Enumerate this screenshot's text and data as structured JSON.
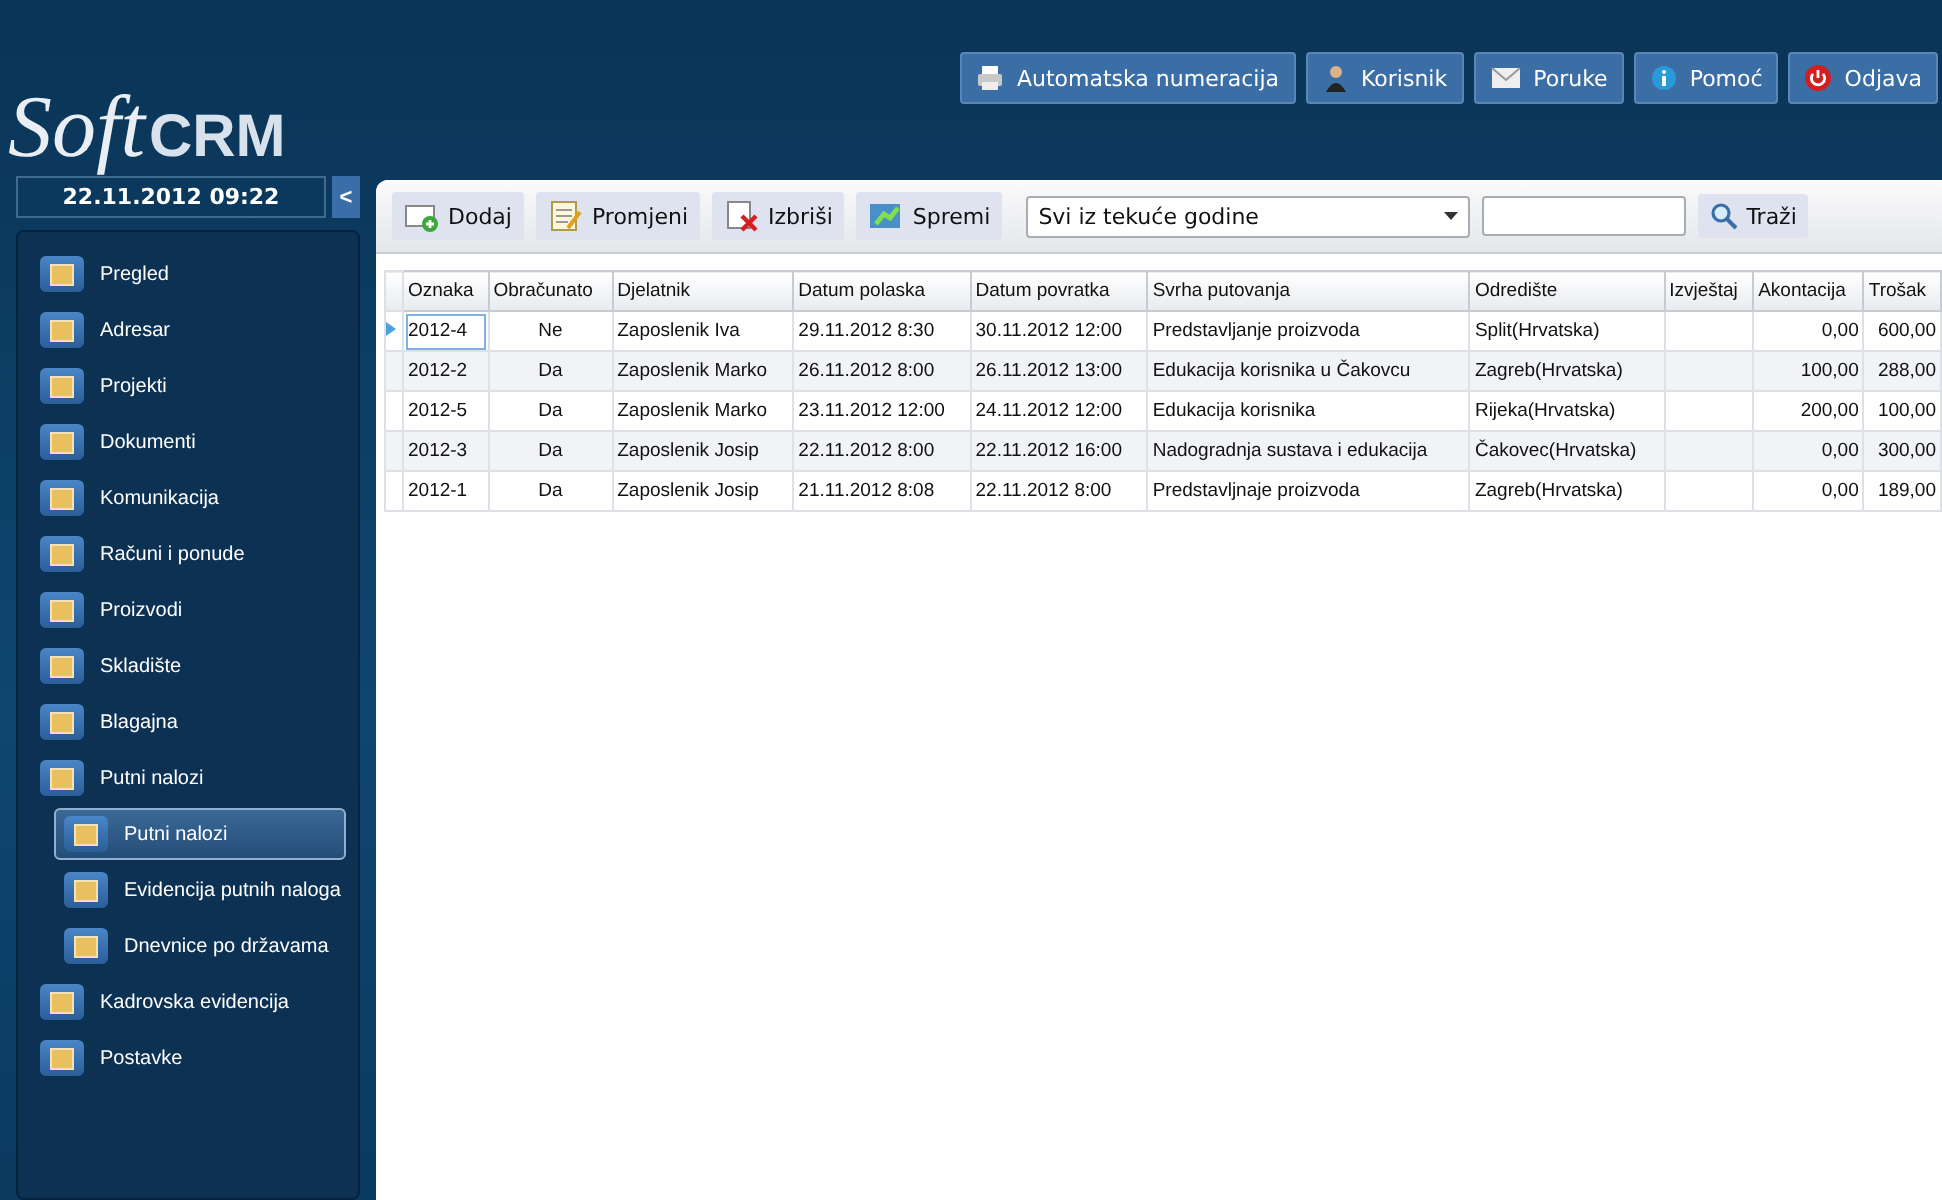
{
  "logo": {
    "part_1": "Soft",
    "part_2": "CRM"
  },
  "top_buttons": [
    {
      "label": "Automatska numeracija",
      "kind": "printer"
    },
    {
      "label": "Korisnik",
      "kind": "user"
    },
    {
      "label": "Poruke",
      "kind": "mail"
    },
    {
      "label": "Pomoć",
      "kind": "info"
    },
    {
      "label": "Odjava",
      "kind": "power"
    }
  ],
  "datetime": "22.11.2012 09:22",
  "collapse_button": "<",
  "sidebar": {
    "items": [
      {
        "label": "Pregled",
        "selected": false
      },
      {
        "label": "Adresar",
        "selected": false
      },
      {
        "label": "Projekti",
        "selected": false
      },
      {
        "label": "Dokumenti",
        "selected": false
      },
      {
        "label": "Komunikacija",
        "selected": false
      },
      {
        "label": "Računi i ponude",
        "selected": false
      },
      {
        "label": "Proizvodi",
        "selected": false
      },
      {
        "label": "Skladište",
        "selected": false
      },
      {
        "label": "Blagajna",
        "selected": false
      },
      {
        "label": "Putni nalozi",
        "selected": false,
        "children": [
          {
            "label": "Putni nalozi",
            "selected": true
          },
          {
            "label": "Evidencija putnih naloga",
            "selected": false
          },
          {
            "label": "Dnevnice po državama",
            "selected": false
          }
        ]
      },
      {
        "label": "Kadrovska evidencija",
        "selected": false
      },
      {
        "label": "Postavke",
        "selected": false
      }
    ]
  },
  "toolbar": {
    "buttons": [
      {
        "label": "Dodaj",
        "kind": "add"
      },
      {
        "label": "Promjeni",
        "kind": "edit"
      },
      {
        "label": "Izbriši",
        "kind": "delete"
      },
      {
        "label": "Spremi",
        "kind": "save"
      }
    ],
    "filter": {
      "value": "Svi iz tekuće godine"
    },
    "search_button": "Traži"
  },
  "table": {
    "columns": [
      "Oznaka",
      "Obračunato",
      "Djelatnik",
      "Datum polaska",
      "Datum povratka",
      "Svrha putovanja",
      "Odredište",
      "Izvještaj",
      "Akontacija",
      "Trošak"
    ],
    "rows": [
      {
        "selected": true,
        "cells": [
          "2012-4",
          "Ne",
          "Zaposlenik Iva",
          "29.11.2012 8:30",
          "30.11.2012 12:00",
          "Predstavljanje proizvoda",
          "Split(Hrvatska)",
          "",
          "0,00",
          "600,00"
        ]
      },
      {
        "selected": false,
        "cells": [
          "2012-2",
          "Da",
          "Zaposlenik Marko",
          "26.11.2012 8:00",
          "26.11.2012 13:00",
          "Edukacija korisnika u Čakovcu",
          "Zagreb(Hrvatska)",
          "",
          "100,00",
          "288,00"
        ]
      },
      {
        "selected": false,
        "cells": [
          "2012-5",
          "Da",
          "Zaposlenik Marko",
          "23.11.2012 12:00",
          "24.11.2012 12:00",
          "Edukacija korisnika",
          "Rijeka(Hrvatska)",
          "",
          "200,00",
          "100,00"
        ]
      },
      {
        "selected": false,
        "cells": [
          "2012-3",
          "Da",
          "Zaposlenik Josip",
          "22.11.2012 8:00",
          "22.11.2012 16:00",
          "Nadogradnja sustava i edukacija",
          "Čakovec(Hrvatska)",
          "",
          "0,00",
          "300,00"
        ]
      },
      {
        "selected": false,
        "cells": [
          "2012-1",
          "Da",
          "Zaposlenik Josip",
          "21.11.2012 8:08",
          "22.11.2012 8:00",
          "Predstavljnaje proizvoda",
          "Zagreb(Hrvatska)",
          "",
          "0,00",
          "189,00"
        ]
      }
    ]
  }
}
